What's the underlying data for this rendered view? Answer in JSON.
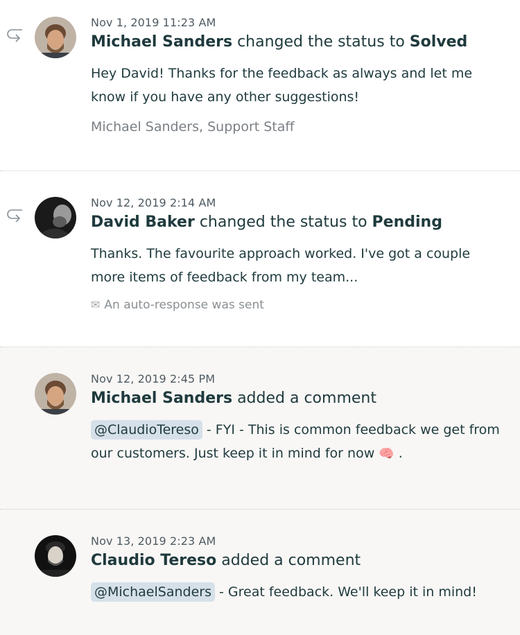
{
  "entries": [
    {
      "timestamp": "Nov 1, 2019 11:23 AM",
      "author": "Michael Sanders",
      "action": "changed the status to",
      "status": "Solved",
      "message": "Hey David! Thanks for the feedback as always and let me know if you have any other suggestions!",
      "signature": "Michael Sanders, Support Staff"
    },
    {
      "timestamp": "Nov 12, 2019 2:14 AM",
      "author": "David Baker",
      "action": "changed the status to",
      "status": "Pending",
      "message": "Thanks. The favourite approach worked. I've got a couple more items of feedback from my team...",
      "auto_response": "An auto-response was sent",
      "auto_icon": "envelope-icon"
    },
    {
      "timestamp": "Nov 12, 2019 2:45 PM",
      "author": "Michael Sanders",
      "action": "added a comment",
      "mention": "@ClaudioTereso",
      "message": " - FYI - This is common feedback we get from our customers. Just keep it in mind for now ",
      "emoji": "🧠",
      "message_end": " ."
    },
    {
      "timestamp": "Nov 13, 2019 2:23 AM",
      "author": "Claudio Tereso",
      "action": "added a comment",
      "mention": "@MichaelSanders",
      "message": " - Great feedback. We'll keep it in mind!"
    }
  ],
  "colors": {
    "text": "#1f3a3d",
    "muted": "#7a7f84",
    "mention_bg": "#d6e0e9",
    "internal_bg": "#f8f7f5"
  }
}
